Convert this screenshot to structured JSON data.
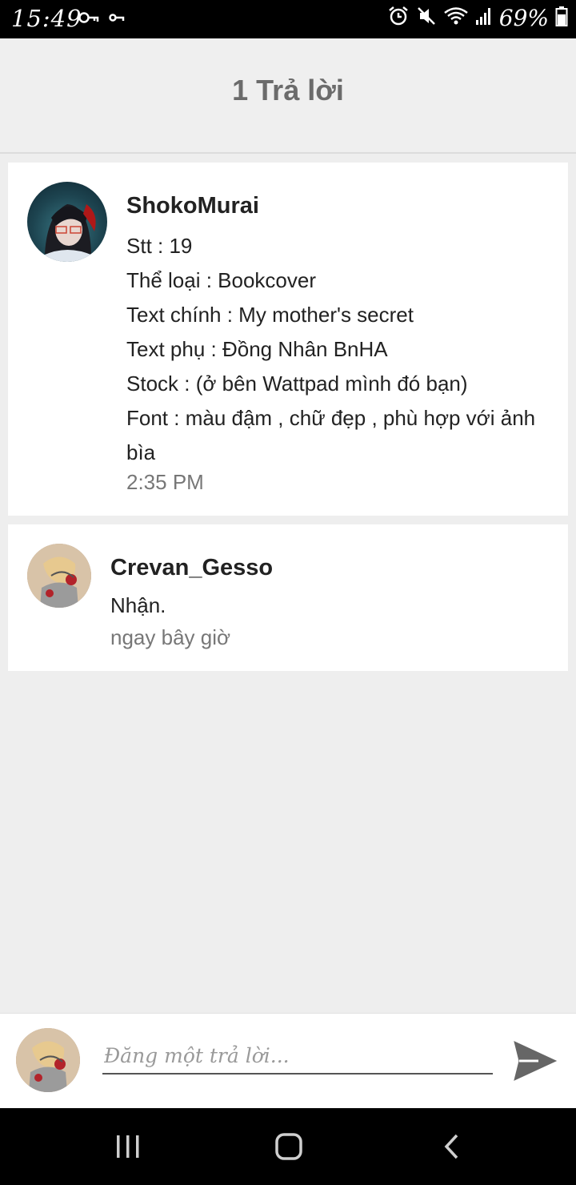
{
  "status_bar": {
    "time": "15:49",
    "battery_text": "69%",
    "left_icons": [
      "key-icon",
      "vpn-key-icon"
    ],
    "right_icons": [
      "alarm-icon",
      "mute-icon",
      "wifi-icon",
      "signal-icon",
      "battery-icon"
    ]
  },
  "header": {
    "title": "1 Trả lời"
  },
  "comments": [
    {
      "username": "ShokoMurai",
      "lines": [
        "Stt : 19",
        "Thể loại : Bookcover",
        "Text chính : My mother's secret",
        "Text phụ : Đồng Nhân BnHA",
        "Stock : (ở bên Wattpad mình đó bạn)",
        "Font : màu đậm , chữ đẹp , phù hợp với ảnh bìa"
      ],
      "timestamp": "2:35 PM"
    },
    {
      "username": "Crevan_Gesso",
      "text": "Nhận.",
      "timestamp": "ngay bây giờ"
    }
  ],
  "compose": {
    "placeholder": "Đăng một trả lời...",
    "value": ""
  },
  "nav_bar": {
    "buttons": [
      "recents-icon",
      "home-icon",
      "back-icon"
    ]
  },
  "colors": {
    "background": "#eeeeee",
    "card": "#ffffff",
    "status_bar": "#000000",
    "header_title": "#6b6b6b",
    "timestamp": "#777777",
    "send_icon": "#666666"
  }
}
